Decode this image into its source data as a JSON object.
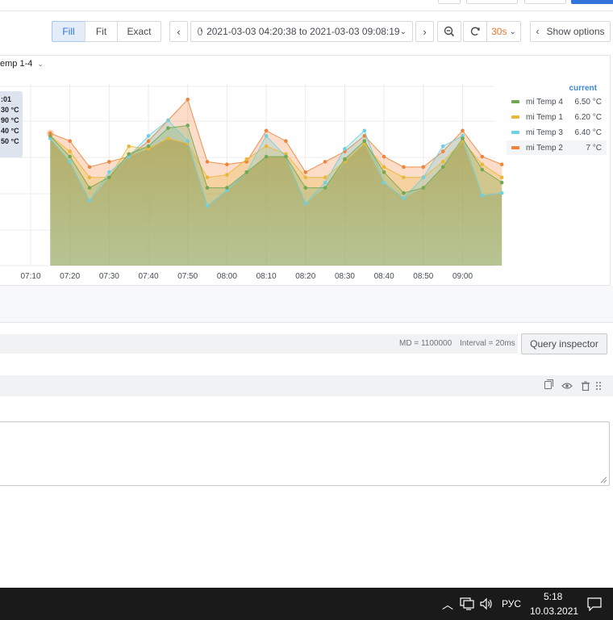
{
  "colors": {
    "accent_blue": "#3274d9",
    "refresh_orange": "#ed7330",
    "legend_header": "#3b86d6",
    "series_green": "#73a853",
    "series_yellow": "#eab839",
    "series_cyan": "#6ed0e0",
    "series_orange": "#ef843c"
  },
  "toolbar": {
    "fill_label": "Fill",
    "fit_label": "Fit",
    "exact_label": "Exact",
    "time_range": "2021-03-03 04:20:38 to 2021-03-03 09:08:19",
    "refresh_interval": "30s",
    "show_options_label": "Show options"
  },
  "panel": {
    "title": "emp 1-4",
    "tooltip_lines": [
      ":01",
      "30 °C",
      "90 °C",
      "40 °C",
      "50 °C"
    ],
    "legend_header": "current",
    "legend": [
      {
        "name": "mi Temp 4",
        "value": "6.50 °C",
        "color": "#73a853"
      },
      {
        "name": "mi Temp 1",
        "value": "6.20 °C",
        "color": "#eab839"
      },
      {
        "name": "mi Temp 3",
        "value": "6.40 °C",
        "color": "#6ed0e0"
      },
      {
        "name": "mi Temp 2",
        "value": "7 °C",
        "color": "#ef843c"
      }
    ]
  },
  "chart_data": {
    "type": "area",
    "x": [
      "07:15",
      "07:20",
      "07:25",
      "07:30",
      "07:35",
      "07:40",
      "07:45",
      "07:50",
      "07:55",
      "08:00",
      "08:05",
      "08:10",
      "08:15",
      "08:20",
      "08:25",
      "08:30",
      "08:35",
      "08:40",
      "08:45",
      "08:50",
      "08:55",
      "09:00",
      "09:05",
      "09:10"
    ],
    "x_tick_labels": [
      "07:10",
      "07:20",
      "07:30",
      "07:40",
      "07:50",
      "08:00",
      "08:10",
      "08:20",
      "08:30",
      "08:40",
      "08:50",
      "09:00"
    ],
    "grid": true,
    "legend_position": "right",
    "series": [
      {
        "name": "mi Temp 2",
        "color": "#ef843c",
        "values": [
          7.1,
          6.8,
          5.8,
          6.0,
          6.2,
          6.8,
          7.6,
          8.4,
          6.0,
          5.9,
          6.0,
          7.2,
          6.8,
          5.6,
          6.0,
          6.4,
          7.0,
          6.2,
          5.8,
          5.8,
          6.4,
          7.2,
          6.2,
          5.9
        ]
      },
      {
        "name": "mi Temp 1",
        "color": "#eab839",
        "values": [
          7.0,
          6.4,
          5.4,
          5.4,
          6.6,
          6.5,
          6.9,
          6.7,
          5.4,
          5.5,
          6.1,
          6.6,
          6.3,
          5.4,
          5.4,
          6.0,
          6.7,
          5.8,
          5.4,
          5.4,
          6.0,
          6.8,
          5.9,
          5.4
        ]
      },
      {
        "name": "mi Temp 3",
        "color": "#6ed0e0",
        "values": [
          6.9,
          6.0,
          4.5,
          5.6,
          6.2,
          7.0,
          7.6,
          6.8,
          4.3,
          4.9,
          5.6,
          7.0,
          6.2,
          4.4,
          5.2,
          6.5,
          7.2,
          5.2,
          4.6,
          5.4,
          6.6,
          7.0,
          4.7,
          4.8
        ]
      },
      {
        "name": "mi Temp 4",
        "color": "#73a853",
        "values": [
          7.0,
          6.2,
          5.0,
          5.4,
          6.3,
          6.6,
          7.3,
          7.4,
          5.0,
          5.0,
          5.6,
          6.2,
          6.2,
          5.0,
          5.0,
          6.1,
          6.8,
          5.6,
          4.8,
          5.0,
          5.8,
          6.9,
          5.7,
          5.2
        ]
      }
    ]
  },
  "query": {
    "md": "MD = 1100000",
    "interval": "Interval = 20ms",
    "inspector_label": "Query inspector"
  },
  "taskbar": {
    "lang": "РУС",
    "time": "5:18",
    "date": "10.03.2021"
  }
}
